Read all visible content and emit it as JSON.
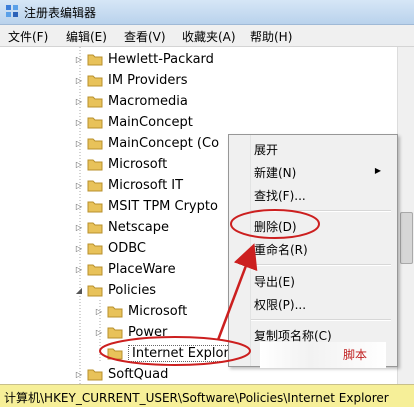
{
  "window": {
    "title": "注册表编辑器"
  },
  "menu": [
    "文件(F)",
    "编辑(E)",
    "查看(V)",
    "收藏夹(A)",
    "帮助(H)"
  ],
  "tree": [
    {
      "label": "Hewlett-Packard",
      "expander": "▷"
    },
    {
      "label": "IM Providers",
      "expander": "▷"
    },
    {
      "label": "Macromedia",
      "expander": "▷"
    },
    {
      "label": "MainConcept",
      "expander": "▷"
    },
    {
      "label": "MainConcept (Co",
      "expander": "▷"
    },
    {
      "label": "Microsoft",
      "expander": "▷"
    },
    {
      "label": "Microsoft IT",
      "expander": "▷"
    },
    {
      "label": "MSIT TPM Crypto",
      "expander": "▷"
    },
    {
      "label": "Netscape",
      "expander": "▷"
    },
    {
      "label": "ODBC",
      "expander": "▷"
    },
    {
      "label": "PlaceWare",
      "expander": "▷"
    },
    {
      "label": "Policies",
      "expander": "◢"
    },
    {
      "label": "Microsoft",
      "expander": "▷"
    },
    {
      "label": "Power",
      "expander": "▷"
    },
    {
      "label": "Internet Explorer",
      "expander": ""
    },
    {
      "label": "SoftQuad",
      "expander": "▷"
    }
  ],
  "context_menu": {
    "items": [
      {
        "label": "展开"
      },
      {
        "label": "新建(N)",
        "submenu": "▶"
      },
      {
        "label": "查找(F)..."
      },
      {
        "label": "删除(D)"
      },
      {
        "label": "重命名(R)"
      },
      {
        "label": "导出(E)"
      },
      {
        "label": "权限(P)..."
      },
      {
        "label": "复制项名称(C)"
      }
    ]
  },
  "status": {
    "path": "计算机\\HKEY_CURRENT_USER\\Software\\Policies\\Internet Explorer"
  },
  "watermark": {
    "text": "脚本"
  },
  "colors": {
    "annotation": "#cc1f1f",
    "status_bg": "#f6ef98",
    "folder": "#e8c25a"
  }
}
